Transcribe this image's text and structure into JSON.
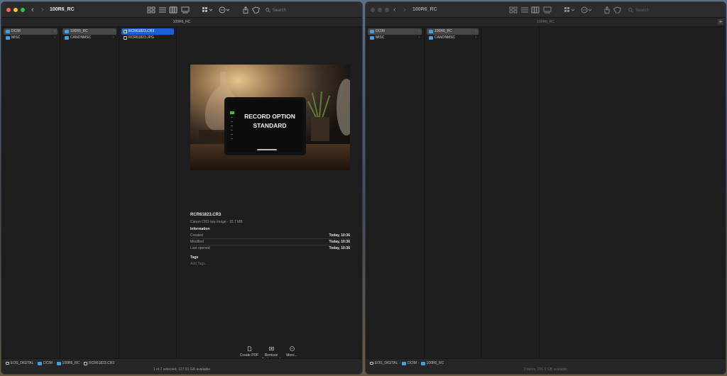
{
  "colors": {
    "window_bg": "#1e1e1e",
    "titlebar_bg": "#2c2c2c",
    "selection_blue": "#1f5fd6",
    "selection_grey": "#464646",
    "folder_blue": "#3fa0e6",
    "light_close": "#ff5f57",
    "light_min": "#febc2e",
    "light_max": "#28c840",
    "light_inactive": "#4c4c4c"
  },
  "left_window": {
    "title": "100R6_RC",
    "path_header": "100R6_RC",
    "search_placeholder": "Search",
    "col1": [
      {
        "label": "DCIM",
        "icon": "folder-icon"
      },
      {
        "label": "MISC",
        "icon": "folder-icon"
      }
    ],
    "col2": [
      {
        "label": "100R6_RC",
        "icon": "folder-icon"
      },
      {
        "label": "CANONMSC",
        "icon": "folder-icon"
      }
    ],
    "col3": [
      {
        "label": "RCR61823.CR3",
        "icon": "raw-file-icon"
      },
      {
        "label": "RCR61823.JPG",
        "icon": "image-file-icon"
      }
    ],
    "preview": {
      "image_text_line1": "RECORD OPTION",
      "image_text_line2": "STANDARD",
      "filename": "RCR61823.CR3",
      "kind": "Canon CR3 raw image - 15.7 MB",
      "info_heading": "Information",
      "info_rows": [
        {
          "label": "Created",
          "value": "Today, 10:36"
        },
        {
          "label": "Modified",
          "value": "Today, 10:36"
        },
        {
          "label": "Last opened",
          "value": "Today, 10:36"
        }
      ],
      "tags_heading": "Tags",
      "tags_placeholder": "Add Tags...",
      "actions": [
        {
          "label": "Create PDF",
          "icon": "create-pdf-icon"
        },
        {
          "label": "Remove Background",
          "icon": "remove-background-icon"
        },
        {
          "label": "More...",
          "icon": "more-icon"
        }
      ]
    },
    "breadcrumb": [
      "EOS_DIGITAL",
      "DCIM",
      "100R6_RC",
      "RCR61823.CR3"
    ],
    "status": "1 of 2 selected, 127.61 GB available"
  },
  "right_window": {
    "title": "100R6_RC",
    "path_header": "100R6_RC",
    "search_placeholder": "Search",
    "col1": [
      {
        "label": "DCIM",
        "icon": "folder-icon"
      },
      {
        "label": "MISC",
        "icon": "folder-icon"
      }
    ],
    "col2": [
      {
        "label": "100R6_RC",
        "icon": "folder-icon"
      },
      {
        "label": "CANONMSC",
        "icon": "folder-icon"
      }
    ],
    "breadcrumb": [
      "EOS_DIGITAL",
      "DCIM",
      "100R6_RC"
    ],
    "status": "2 items, 235.5 GB available"
  }
}
